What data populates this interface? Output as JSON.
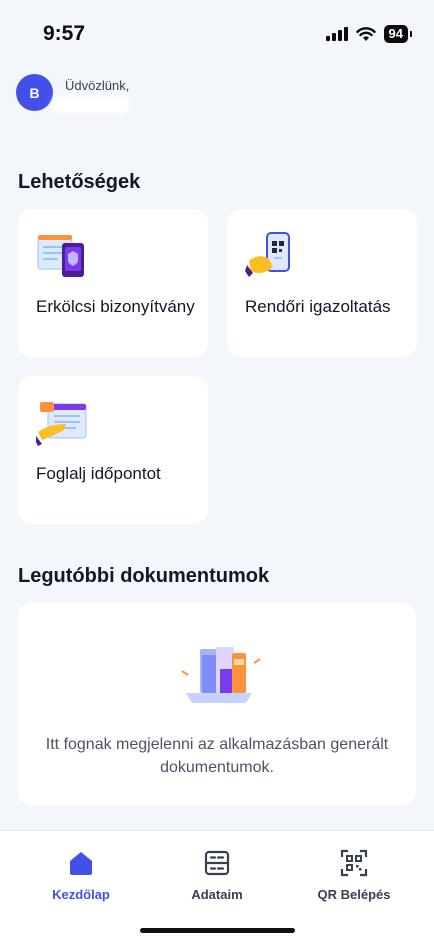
{
  "status_bar": {
    "time": "9:57",
    "battery": "94"
  },
  "greeting": {
    "avatar_initial": "B",
    "welcome": "Üdvözlünk,"
  },
  "options": {
    "title": "Lehetőségek",
    "items": [
      {
        "label": "Erkölcsi bizonyítvány",
        "icon": "certificate-icon"
      },
      {
        "label": "Rendőri igazoltatás",
        "icon": "phone-qr-icon"
      },
      {
        "label": "Foglalj időpontot",
        "icon": "calendar-hand-icon"
      }
    ]
  },
  "documents": {
    "title": "Legutóbbi dokumentumok",
    "empty_text": "Itt fognak megjelenni az alkalmazásban generált dokumentumok."
  },
  "nav": {
    "items": [
      {
        "label": "Kezdőlap",
        "icon": "home-icon",
        "active": true
      },
      {
        "label": "Adataim",
        "icon": "data-list-icon",
        "active": false
      },
      {
        "label": "QR Belépés",
        "icon": "qr-scan-icon",
        "active": false
      }
    ]
  },
  "colors": {
    "accent": "#4350e8",
    "background": "#f3f6fb",
    "card": "#ffffff"
  }
}
